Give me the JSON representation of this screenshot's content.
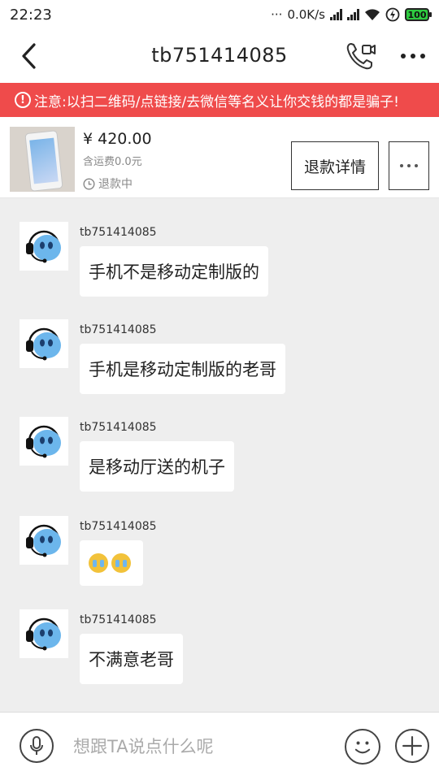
{
  "status_bar": {
    "time": "22:23",
    "network_speed": "0.0K/s",
    "battery": "100"
  },
  "header": {
    "title": "tb751414085",
    "icons": [
      "back-icon",
      "video-call-icon",
      "more-icon"
    ]
  },
  "warning": {
    "text": "注意:以扫二维码/点链接/去微信等名义让你交钱的都是骗子!"
  },
  "product": {
    "price": "¥ 420.00",
    "shipping": "含运费0.0元",
    "status": "退款中",
    "refund_button": "退款详情"
  },
  "messages": [
    {
      "sender": "tb751414085",
      "text": "手机不是移动定制版的"
    },
    {
      "sender": "tb751414085",
      "text": "手机是移动定制版的老哥"
    },
    {
      "sender": "tb751414085",
      "text": "是移动厅送的机子"
    },
    {
      "sender": "tb751414085",
      "text": "",
      "emoji": "crying-face-emoji",
      "emoji_count": 2
    },
    {
      "sender": "tb751414085",
      "text": "不满意老哥"
    }
  ],
  "input_bar": {
    "placeholder": "想跟TA说点什么呢"
  },
  "colors": {
    "warning_bg": "#ef4b4b",
    "accent": "#ff5000"
  }
}
